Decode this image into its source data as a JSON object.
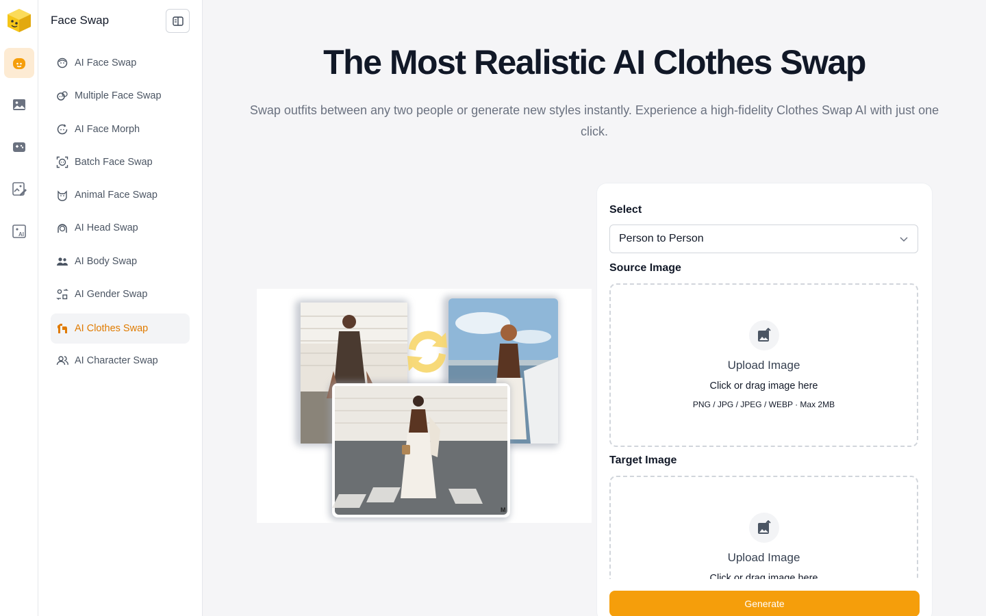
{
  "sidebar": {
    "title": "Face Swap",
    "items": [
      {
        "label": "AI Face Swap",
        "icon": "face-icon"
      },
      {
        "label": "Multiple Face Swap",
        "icon": "multiple-faces-icon"
      },
      {
        "label": "AI Face Morph",
        "icon": "face-morph-icon"
      },
      {
        "label": "Batch Face Swap",
        "icon": "batch-face-icon"
      },
      {
        "label": "Animal Face Swap",
        "icon": "cat-icon"
      },
      {
        "label": "AI Head Swap",
        "icon": "head-icon"
      },
      {
        "label": "AI Body Swap",
        "icon": "people-icon"
      },
      {
        "label": "AI Gender Swap",
        "icon": "gender-swap-icon"
      },
      {
        "label": "AI Clothes Swap",
        "icon": "shirt-icon",
        "active": true
      },
      {
        "label": "AI Character Swap",
        "icon": "character-icon"
      }
    ]
  },
  "rail": {
    "items": [
      "face-swap-icon",
      "image-icon",
      "video-game-icon",
      "edit-image-icon",
      "ai-image-icon"
    ]
  },
  "hero": {
    "title": "The Most Realistic AI Clothes Swap",
    "subtitle": "Swap outfits between any two people or generate new styles instantly. Experience a high-fidelity Clothes Swap AI with just one click."
  },
  "panel": {
    "select_label": "Select",
    "select_value": "Person to Person",
    "source_label": "Source Image",
    "target_label": "Target Image",
    "upload_title": "Upload Image",
    "upload_hint": "Click or drag image here",
    "upload_formats": "PNG / JPG / JPEG / WEBP · Max 2MB",
    "generate_label": "Generate"
  },
  "colors": {
    "accent": "#f59e0b",
    "active_text": "#e07b00",
    "active_rail_bg": "#fdebd3"
  }
}
